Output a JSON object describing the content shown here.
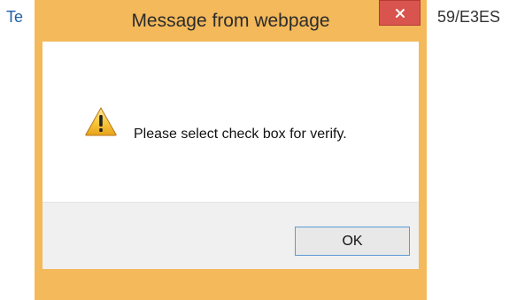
{
  "background": {
    "left_text": "Te",
    "right_text": "59/E3ES"
  },
  "dialog": {
    "title": "Message from webpage",
    "close_glyph": "×",
    "message": "Please select check box for verify.",
    "icon": "warning-icon",
    "ok_label": "OK"
  },
  "colors": {
    "frame": "#f3b95a",
    "close_button": "#d9534f",
    "ok_border": "#5b9ad6",
    "link_text": "#1f5fa8"
  }
}
